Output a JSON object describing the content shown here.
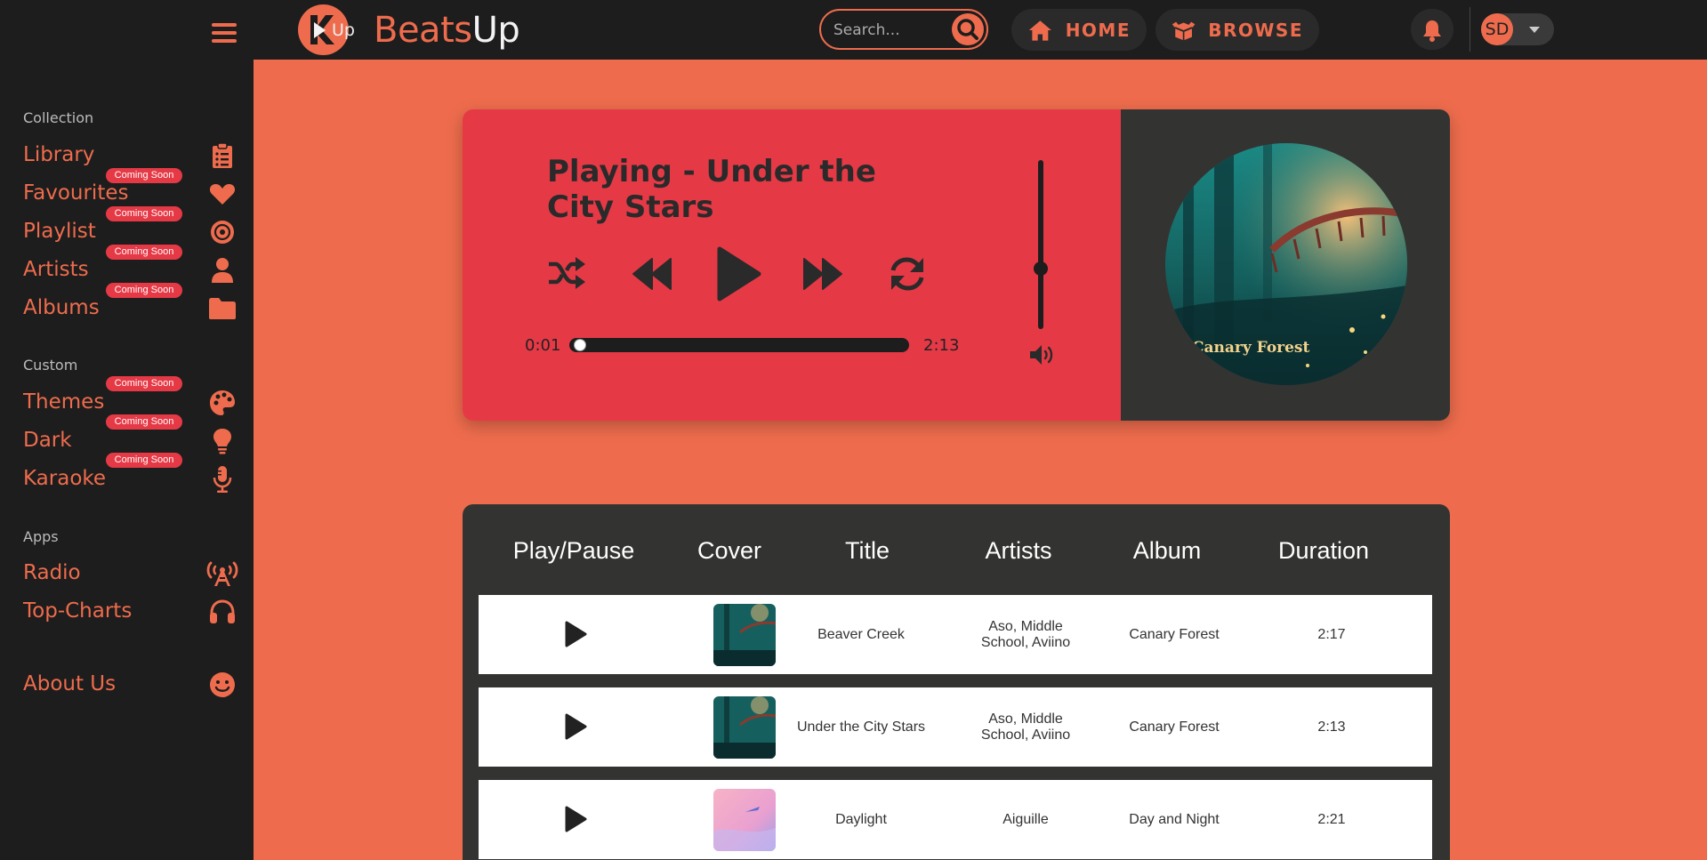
{
  "header": {
    "brand_part1": "Beats",
    "brand_part2": "Up",
    "logo_text": "Up",
    "search_placeholder": "Search...",
    "nav": [
      {
        "label": "HOME",
        "icon": "home-icon"
      },
      {
        "label": "BROWSE",
        "icon": "box-open-icon"
      }
    ],
    "user_initials": "SD"
  },
  "sidebar": {
    "sections": [
      {
        "title": "Collection",
        "items": [
          {
            "label": "Library",
            "icon": "clipboard-list-icon",
            "badge": ""
          },
          {
            "label": "Favourites",
            "icon": "heart-icon",
            "badge": "Coming Soon"
          },
          {
            "label": "Playlist",
            "icon": "record-vinyl-icon",
            "badge": "Coming Soon"
          },
          {
            "label": "Artists",
            "icon": "user-icon",
            "badge": "Coming Soon"
          },
          {
            "label": "Albums",
            "icon": "folder-icon",
            "badge": "Coming Soon"
          }
        ]
      },
      {
        "title": "Custom",
        "items": [
          {
            "label": "Themes",
            "icon": "palette-icon",
            "badge": "Coming Soon"
          },
          {
            "label": "Dark",
            "icon": "lightbulb-icon",
            "badge": "Coming Soon"
          },
          {
            "label": "Karaoke",
            "icon": "microphone-icon",
            "badge": "Coming Soon"
          }
        ]
      },
      {
        "title": "Apps",
        "items": [
          {
            "label": "Radio",
            "icon": "broadcast-tower-icon",
            "badge": ""
          },
          {
            "label": "Top-Charts",
            "icon": "headphones-icon",
            "badge": ""
          }
        ]
      }
    ],
    "about": {
      "label": "About Us",
      "icon": "smile-icon"
    }
  },
  "player": {
    "now_playing": "Playing - Under the City Stars",
    "current_time": "0:01",
    "total_time": "2:13",
    "progress_fraction": 0.008,
    "volume_fraction": 0.3,
    "album_art_caption": "Canary Forest"
  },
  "tracks": {
    "columns": [
      "Play/Pause",
      "Cover",
      "Title",
      "Artists",
      "Album",
      "Duration"
    ],
    "rows": [
      {
        "title": "Beaver Creek",
        "artists": "Aso, Middle School, Aviino",
        "album": "Canary Forest",
        "duration": "2:17",
        "cover": "canary-forest"
      },
      {
        "title": "Under the City Stars",
        "artists": "Aso, Middle School, Aviino",
        "album": "Canary Forest",
        "duration": "2:13",
        "cover": "canary-forest"
      },
      {
        "title": "Daylight",
        "artists": "Aiguille",
        "album": "Day and Night",
        "duration": "2:21",
        "cover": "day-and-night"
      }
    ]
  },
  "colors": {
    "accent": "#ee6c4d",
    "player_red": "#e63946",
    "dark": "#1d1d1d",
    "panel": "#333431"
  }
}
